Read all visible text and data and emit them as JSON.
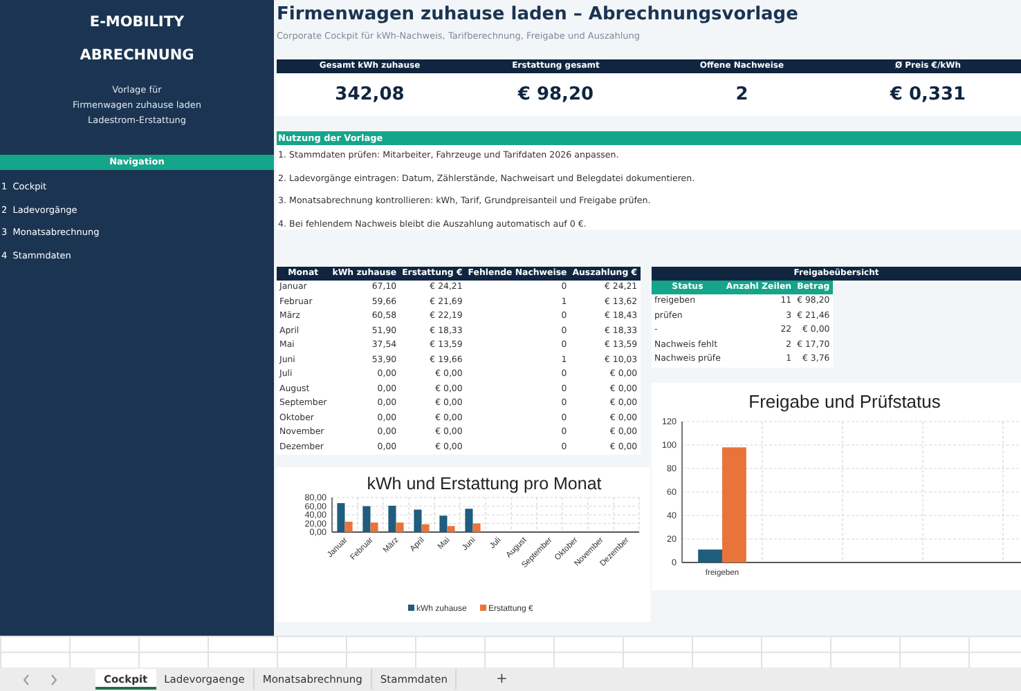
{
  "sidebar": {
    "title_lines": [
      "E-MOBILITY",
      "ABRECHNUNG"
    ],
    "description_lines": [
      "Vorlage für",
      "Firmenwagen zuhause laden",
      "Ladestrom-Erstattung"
    ],
    "navigation_heading": "Navigation",
    "nav_items": [
      {
        "label": "1  Cockpit"
      },
      {
        "label": "2  Ladevorgänge"
      },
      {
        "label": "3  Monatsabrechnung"
      },
      {
        "label": "4  Stammdaten"
      }
    ]
  },
  "header": {
    "title": "Firmenwagen zuhause laden – Abrechnungsvorlage",
    "subtitle": "Corporate Cockpit für kWh-Nachweis, Tarifberechnung, Freigabe und Auszahlung"
  },
  "kpis": [
    {
      "label": "Gesamt kWh zuhause",
      "value": "342,08"
    },
    {
      "label": "Erstattung gesamt",
      "value": "€ 98,20"
    },
    {
      "label": "Offene Nachweise",
      "value": "2"
    },
    {
      "label": "Ø Preis €/kWh",
      "value": "€ 0,331"
    }
  ],
  "usage": {
    "heading": "Nutzung der Vorlage",
    "steps": [
      "1. Stammdaten prüfen: Mitarbeiter, Fahrzeuge und Tarifdaten 2026 anpassen.",
      "2. Ladevorgänge eintragen: Datum, Zählerstände, Nachweisart und Belegdatei dokumentieren.",
      "3. Monatsabrechnung kontrollieren: kWh, Tarif, Grundpreisanteil und Freigabe prüfen.",
      "4. Bei fehlendem Nachweis bleibt die Auszahlung automatisch auf 0 €."
    ]
  },
  "monthly_table": {
    "columns": [
      "Monat",
      "kWh zuhause",
      "Erstattung €",
      "Fehlende Nachweise",
      "Auszahlung €"
    ],
    "rows": [
      [
        "Januar",
        "67,10",
        "€ 24,21",
        "0",
        "€ 24,21"
      ],
      [
        "Februar",
        "59,66",
        "€ 21,69",
        "1",
        "€ 13,62"
      ],
      [
        "März",
        "60,58",
        "€ 22,19",
        "0",
        "€ 18,43"
      ],
      [
        "April",
        "51,90",
        "€ 18,33",
        "0",
        "€ 18,33"
      ],
      [
        "Mai",
        "37,54",
        "€ 13,59",
        "0",
        "€ 13,59"
      ],
      [
        "Juni",
        "53,90",
        "€ 19,66",
        "1",
        "€ 10,03"
      ],
      [
        "Juli",
        "0,00",
        "€ 0,00",
        "0",
        "€ 0,00"
      ],
      [
        "August",
        "0,00",
        "€ 0,00",
        "0",
        "€ 0,00"
      ],
      [
        "September",
        "0,00",
        "€ 0,00",
        "0",
        "€ 0,00"
      ],
      [
        "Oktober",
        "0,00",
        "€ 0,00",
        "0",
        "€ 0,00"
      ],
      [
        "November",
        "0,00",
        "€ 0,00",
        "0",
        "€ 0,00"
      ],
      [
        "Dezember",
        "0,00",
        "€ 0,00",
        "0",
        "€ 0,00"
      ]
    ]
  },
  "monthly_chart": {
    "chart_data": {
      "type": "bar",
      "title": "kWh und Erstattung pro Monat",
      "categories": [
        "Januar",
        "Februar",
        "März",
        "April",
        "Mai",
        "Juni",
        "Juli",
        "August",
        "September",
        "Oktober",
        "November",
        "Dezember"
      ],
      "series": [
        {
          "name": "kWh zuhause",
          "color": "#1f5c7e",
          "values": [
            67,
            60,
            61,
            52,
            38,
            54,
            0,
            0,
            0,
            0,
            0,
            0
          ]
        },
        {
          "name": "Erstattung €",
          "color": "#e8743b",
          "values": [
            24,
            22,
            22,
            18,
            14,
            20,
            0,
            0,
            0,
            0,
            0,
            0
          ]
        }
      ],
      "grid": true,
      "legend": true,
      "ylim": [
        0,
        80
      ],
      "yticks": [
        {
          "value": 0,
          "label": "0,00"
        },
        {
          "value": 20,
          "label": "20,00"
        },
        {
          "value": 40,
          "label": "40,00"
        },
        {
          "value": 60,
          "label": "60,00"
        },
        {
          "value": 80,
          "label": "80,00"
        }
      ]
    }
  },
  "approval": {
    "title": "Freigabeübersicht",
    "columns": [
      "Status",
      "Anzahl Zeilen",
      "Betrag"
    ],
    "rows": [
      [
        "freigeben",
        "11",
        "€ 98,20"
      ],
      [
        "prüfen",
        "3",
        "€ 21,46"
      ],
      [
        "-",
        "22",
        "€ 0,00"
      ],
      [
        "Nachweis fehlt",
        "2",
        "€ 17,70"
      ],
      [
        "Nachweis prüfe",
        "1",
        "€ 3,76"
      ]
    ],
    "chart_data": {
      "type": "bar",
      "title": "Freigabe und Prüfstatus",
      "categories": [
        "freigeben"
      ],
      "series": [
        {
          "color": "#1f5c7e",
          "values": [
            11
          ]
        },
        {
          "color": "#e8743b",
          "values": [
            98
          ]
        }
      ],
      "grid": true,
      "ylim": [
        0,
        120
      ],
      "yticks": [
        0,
        20,
        40,
        60,
        80,
        100,
        120
      ]
    }
  },
  "sheet_tabs": [
    {
      "label": "Cockpit",
      "selected": true
    },
    {
      "label": "Ladevorgaenge",
      "selected": false
    },
    {
      "label": "Monatsabrechnung",
      "selected": false
    },
    {
      "label": "Stammdaten",
      "selected": false
    }
  ],
  "add_sheet": "+"
}
